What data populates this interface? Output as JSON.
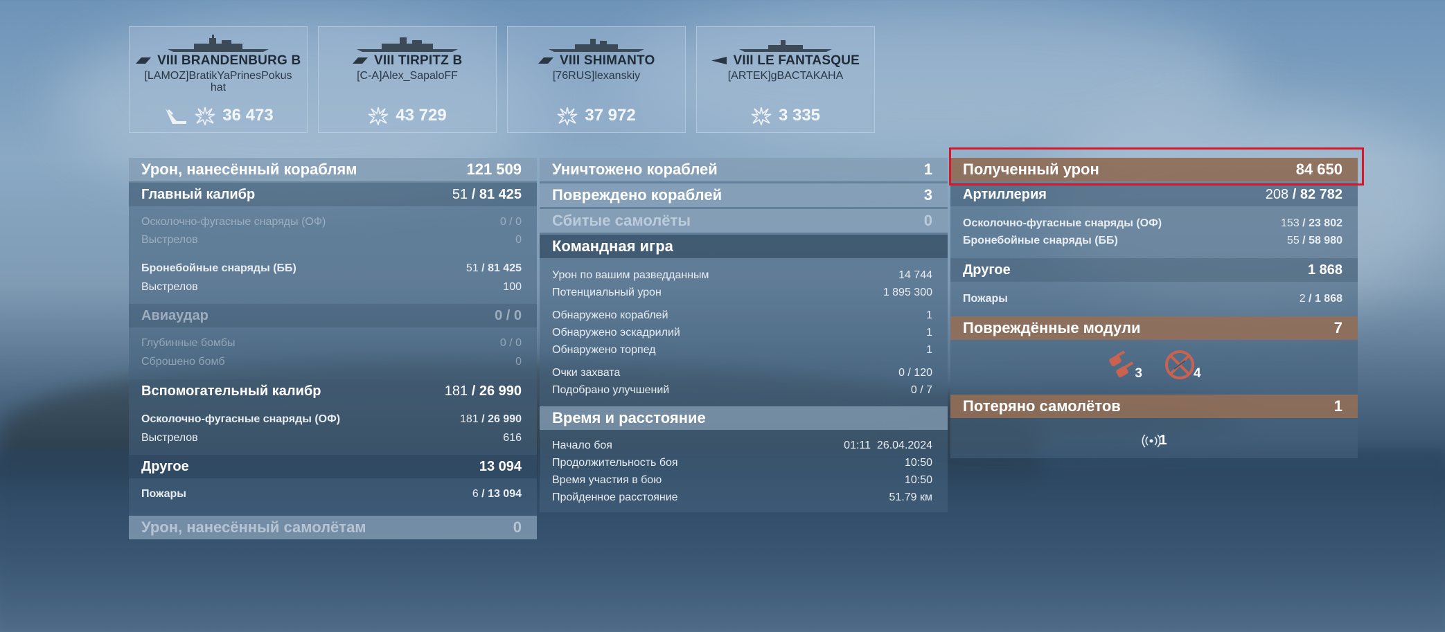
{
  "ships": [
    {
      "tier": "VIII",
      "name": "BRANDENBURG B",
      "player": "[LAMOZ]BratikYaPrinesPokus hat",
      "damage": "36 473",
      "sunk": true
    },
    {
      "tier": "VIII",
      "name": "TIRPITZ B",
      "player": "[C-A]Alex_SapaloFF",
      "damage": "43 729",
      "sunk": false
    },
    {
      "tier": "VIII",
      "name": "SHIMANTO",
      "player": "[76RUS]lexanskiy",
      "damage": "37 972",
      "sunk": false
    },
    {
      "tier": "VIII",
      "name": "LE FANTASQUE",
      "player": "[ARTEK]gBACTAKAHA",
      "damage": "3 335",
      "sunk": false
    }
  ],
  "left": {
    "dealt": {
      "label": "Урон, нанесённый кораблям",
      "value": "121 509"
    },
    "main": {
      "label": "Главный калибр",
      "value_a": "51",
      "value_b": "81 425"
    },
    "he": {
      "label": "Осколочно-фугасные снаряды (ОФ)",
      "value": "0 / 0"
    },
    "he_shots": {
      "label": "Выстрелов",
      "value": "0"
    },
    "ap": {
      "label": "Бронебойные снаряды (ББ)",
      "value_a": "51",
      "value_b": "81 425"
    },
    "ap_shots": {
      "label": "Выстрелов",
      "value": "100"
    },
    "air": {
      "label": "Авиаудар",
      "value": "0 / 0"
    },
    "depth": {
      "label": "Глубинные бомбы",
      "value": "0 / 0"
    },
    "bombs": {
      "label": "Сброшено бомб",
      "value": "0"
    },
    "secondary": {
      "label": "Вспомогательный калибр",
      "value_a": "181",
      "value_b": "26 990"
    },
    "sec_he": {
      "label": "Осколочно-фугасные снаряды (ОФ)",
      "value_a": "181",
      "value_b": "26 990"
    },
    "sec_shots": {
      "label": "Выстрелов",
      "value": "616"
    },
    "other": {
      "label": "Другое",
      "value": "13 094"
    },
    "fires": {
      "label": "Пожары",
      "value_a": "6",
      "value_b": "13 094"
    },
    "planes": {
      "label": "Урон, нанесённый самолётам",
      "value": "0"
    }
  },
  "middle": {
    "destroyed": {
      "label": "Уничтожено кораблей",
      "value": "1"
    },
    "damaged": {
      "label": "Повреждено кораблей",
      "value": "3"
    },
    "shotdown": {
      "label": "Сбитые самолёты",
      "value": "0"
    },
    "team": {
      "label": "Командная игра"
    },
    "spotted_dmg": {
      "label": "Урон по вашим разведданным",
      "value": "14 744"
    },
    "potential": {
      "label": "Потенциальный урон",
      "value": "1 895 300"
    },
    "spot_ships": {
      "label": "Обнаружено кораблей",
      "value": "1"
    },
    "spot_squad": {
      "label": "Обнаружено эскадрилий",
      "value": "1"
    },
    "spot_torp": {
      "label": "Обнаружено торпед",
      "value": "1"
    },
    "capture": {
      "label": "Очки захвата",
      "value": "0 / 120"
    },
    "upgrades": {
      "label": "Подобрано улучшений",
      "value": "0 / 7"
    },
    "time": {
      "label": "Время и расстояние"
    },
    "start": {
      "label": "Начало боя",
      "value": "01:11  26.04.2024"
    },
    "duration": {
      "label": "Продолжительность боя",
      "value": "10:50"
    },
    "participation": {
      "label": "Время участия в бою",
      "value": "10:50"
    },
    "distance": {
      "label": "Пройденное расстояние",
      "value": "51.79 км"
    }
  },
  "right": {
    "received": {
      "label": "Полученный урон",
      "value": "84 650"
    },
    "artillery": {
      "label": "Артиллерия",
      "value_a": "208",
      "value_b": "82 782"
    },
    "he": {
      "label": "Осколочно-фугасные снаряды (ОФ)",
      "value_a": "153",
      "value_b": "23 802"
    },
    "ap": {
      "label": "Бронебойные снаряды (ББ)",
      "value_a": "55",
      "value_b": "58 980"
    },
    "other": {
      "label": "Другое",
      "value": "1 868"
    },
    "fires": {
      "label": "Пожары",
      "value_a": "2",
      "value_b": "1 868"
    },
    "modules": {
      "label": "Повреждённые модули",
      "value": "7",
      "turret_count": "3",
      "aa_count": "4"
    },
    "lost_planes": {
      "label": "Потеряно самолётов",
      "value": "1",
      "icon_count": "1"
    }
  },
  "colors": {
    "highlight": "#d5182a",
    "orange_header": "#96705a"
  }
}
